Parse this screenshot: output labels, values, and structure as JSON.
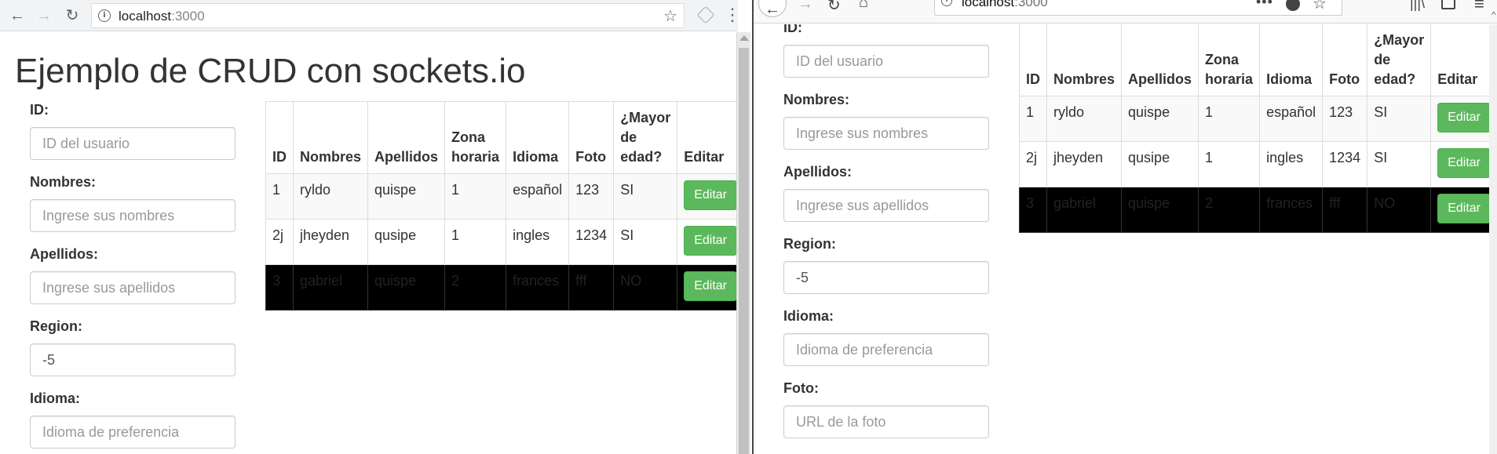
{
  "left_browser": {
    "url_host": "localhost",
    "url_port": ":3000",
    "icons": {
      "back": "back-arrow-icon",
      "forward": "forward-arrow-icon",
      "reload": "reload-icon",
      "info": "info-icon",
      "star": "bookmark-star-icon",
      "extension": "extension-icon",
      "menu": "kebab-menu-icon"
    }
  },
  "right_browser": {
    "url_host": "localhost",
    "url_port": ":3000",
    "icons": {
      "back": "back-arrow-icon",
      "forward": "forward-arrow-icon",
      "reload": "reload-icon",
      "home": "home-icon",
      "info": "info-icon",
      "page_actions": "more-dots-icon",
      "pocket": "pocket-icon",
      "star": "bookmark-star-icon",
      "library": "library-icon",
      "sidebar": "sidebar-icon",
      "menu": "hamburger-menu-icon"
    }
  },
  "page": {
    "title": "Ejemplo de CRUD con sockets.io"
  },
  "form": {
    "id": {
      "label": "ID:",
      "placeholder": "ID del usuario",
      "value": ""
    },
    "nombres": {
      "label": "Nombres:",
      "placeholder": "Ingrese sus nombres",
      "value": ""
    },
    "apellidos": {
      "label": "Apellidos:",
      "placeholder": "Ingrese sus apellidos",
      "value": ""
    },
    "region": {
      "label": "Region:",
      "placeholder": "",
      "value": "-5"
    },
    "idioma": {
      "label": "Idioma:",
      "placeholder": "Idioma de preferencia",
      "value": ""
    },
    "foto": {
      "label": "Foto:",
      "placeholder": "URL de la foto",
      "value": ""
    }
  },
  "table": {
    "headers": [
      "ID",
      "Nombres",
      "Apellidos",
      "Zona horaria",
      "Idioma",
      "Foto",
      "¿Mayor de edad?",
      "Editar"
    ],
    "header_lines": {
      "zona": [
        "Zona",
        "horaria"
      ],
      "mayor": [
        "¿Mayor",
        "de",
        "edad?"
      ]
    },
    "rows": [
      {
        "id": "1",
        "nombres": "ryldo",
        "apellidos": "quispe",
        "zona": "1",
        "idioma": "español",
        "foto": "123",
        "mayor": "SI",
        "edit": "Editar",
        "style": "odd"
      },
      {
        "id": "2j",
        "nombres": "jheyden",
        "apellidos": "qusipe",
        "zona": "1",
        "idioma": "ingles",
        "foto": "1234",
        "mayor": "SI",
        "edit": "Editar",
        "style": "even"
      },
      {
        "id": "3",
        "nombres": "gabriel",
        "apellidos": "quispe",
        "zona": "2",
        "idioma": "frances",
        "foto": "fff",
        "mayor": "NO",
        "edit": "Editar",
        "style": "dark"
      }
    ]
  },
  "colors": {
    "success": "#5cb85c",
    "dark_row": "#000000",
    "striped_row": "#f9f9f9"
  }
}
